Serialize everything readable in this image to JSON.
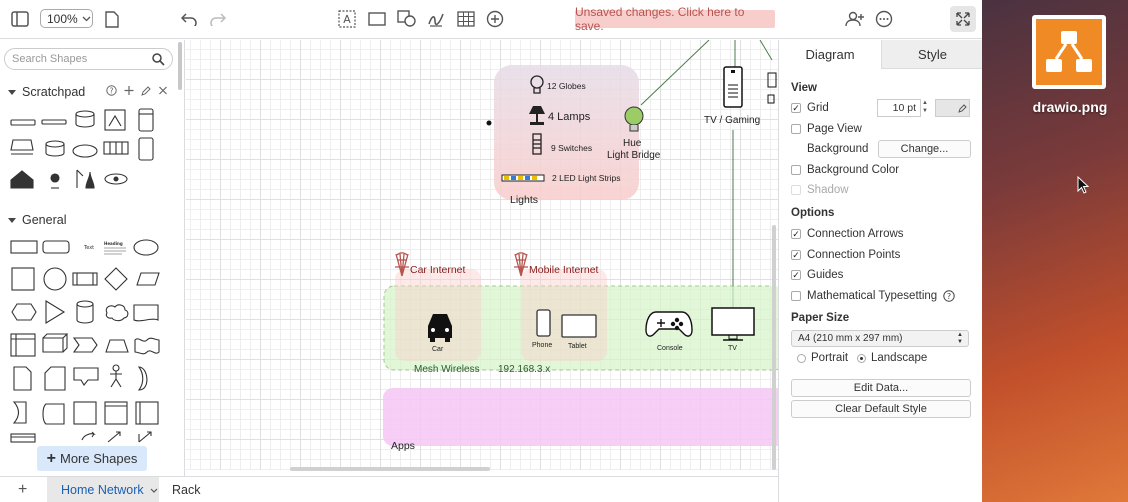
{
  "toolbar": {
    "zoom": "100%",
    "unsaved_notice": "Unsaved changes. Click here to save."
  },
  "left_panel": {
    "search_placeholder": "Search Shapes",
    "scratchpad_title": "Scratchpad",
    "general_title": "General",
    "more_shapes_label": "More Shapes",
    "general_text_sample": "Text",
    "general_heading_sample": "Heading"
  },
  "canvas": {
    "lights_group": "Lights",
    "globes": "12 Globes",
    "lamps": "4 Lamps",
    "switches": "9 Switches",
    "led": "2 LED Light Strips",
    "hue_line1": "Hue",
    "hue_line2": "Light Bridge",
    "tv_gaming": "TV / Gaming",
    "car_internet": "Car Internet",
    "mobile_internet": "Mobile Internet",
    "car": "Car",
    "phone": "Phone",
    "tablet": "Tablet",
    "console": "Console",
    "tv": "TV",
    "mesh": "Mesh Wireless",
    "subnet": "192.168.3.x",
    "apps": "Apps"
  },
  "right_panel": {
    "tabs": [
      "Diagram",
      "Style"
    ],
    "view_title": "View",
    "grid_label": "Grid",
    "grid_size": "10 pt",
    "page_view_label": "Page View",
    "background_label": "Background",
    "change_button": "Change...",
    "background_color_label": "Background Color",
    "shadow_label": "Shadow",
    "options_title": "Options",
    "connection_arrows": "Connection Arrows",
    "connection_points": "Connection Points",
    "guides": "Guides",
    "math_typesetting": "Mathematical Typesetting",
    "paper_size_title": "Paper Size",
    "paper_size_value": "A4 (210 mm x 297 mm)",
    "portrait": "Portrait",
    "landscape": "Landscape",
    "edit_data_button": "Edit Data...",
    "clear_style_button": "Clear Default Style"
  },
  "bottom": {
    "pages": [
      "Home Network",
      "Rack"
    ]
  },
  "desktop": {
    "file_label": "drawio.png",
    "accent": "#f08a24"
  }
}
